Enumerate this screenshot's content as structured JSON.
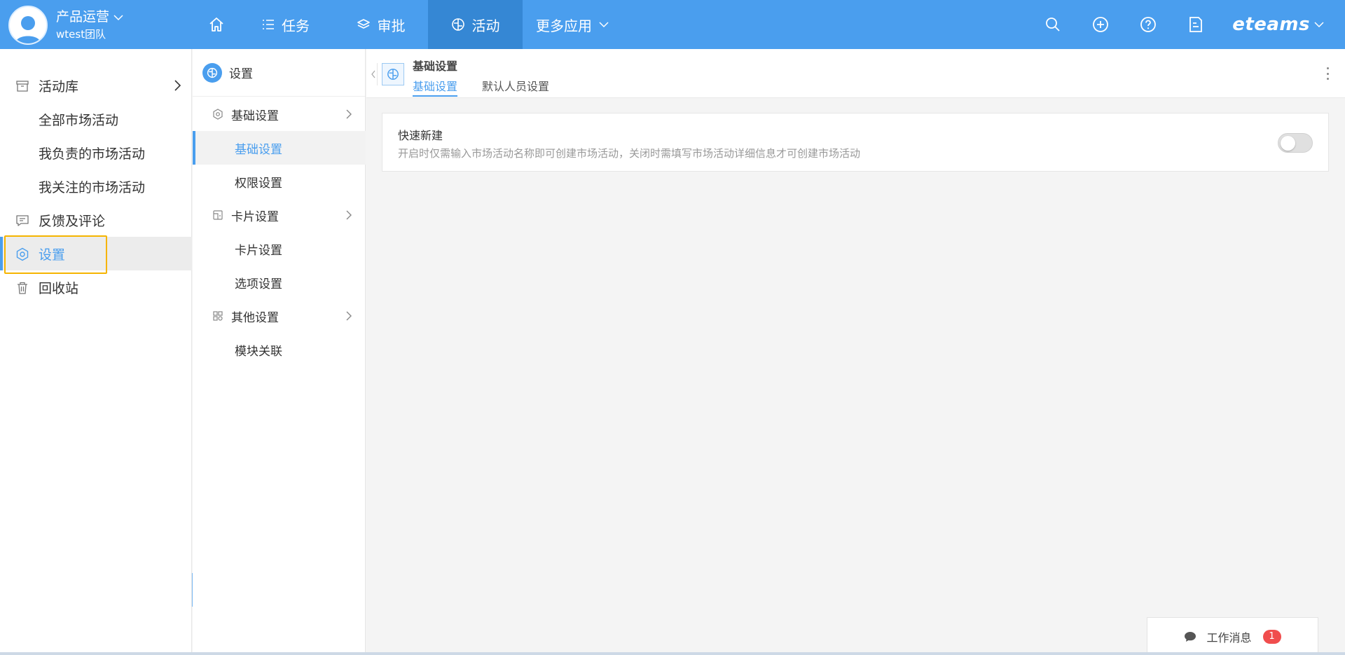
{
  "header": {
    "team_name": "产品运营",
    "team_sub": "wtest团队",
    "nav": [
      {
        "label": "",
        "icon": "home-icon"
      },
      {
        "label": "任务",
        "icon": "list-icon"
      },
      {
        "label": "审批",
        "icon": "layers-icon"
      },
      {
        "label": "活动",
        "icon": "activity-icon"
      },
      {
        "label": "更多应用",
        "icon": "chevron-down-icon"
      }
    ],
    "brand": "eteams",
    "accent_color": "#4a9eee"
  },
  "sidebar": {
    "items": [
      {
        "label": "活动库",
        "icon": "archive-icon"
      },
      {
        "label": "全部市场活动"
      },
      {
        "label": "我负责的市场活动"
      },
      {
        "label": "我关注的市场活动"
      },
      {
        "label": "反馈及评论",
        "icon": "comment-icon"
      },
      {
        "label": "设置",
        "icon": "settings-icon"
      },
      {
        "label": "回收站",
        "icon": "trash-icon"
      }
    ]
  },
  "settings_panel": {
    "title": "设置",
    "items": [
      {
        "label": "基础设置"
      },
      {
        "label": "基础设置"
      },
      {
        "label": "权限设置"
      },
      {
        "label": "卡片设置"
      },
      {
        "label": "卡片设置"
      },
      {
        "label": "选项设置"
      },
      {
        "label": "其他设置"
      },
      {
        "label": "模块关联"
      }
    ]
  },
  "main": {
    "title": "基础设置",
    "tabs": [
      {
        "label": "基础设置"
      },
      {
        "label": "默认人员设置"
      }
    ],
    "card": {
      "title": "快速新建",
      "description": "开启时仅需输入市场活动名称即可创建市场活动，关闭时需填写市场活动详细信息才可创建市场活动",
      "enabled": false
    }
  },
  "messages": {
    "label": "工作消息",
    "count": "1"
  }
}
